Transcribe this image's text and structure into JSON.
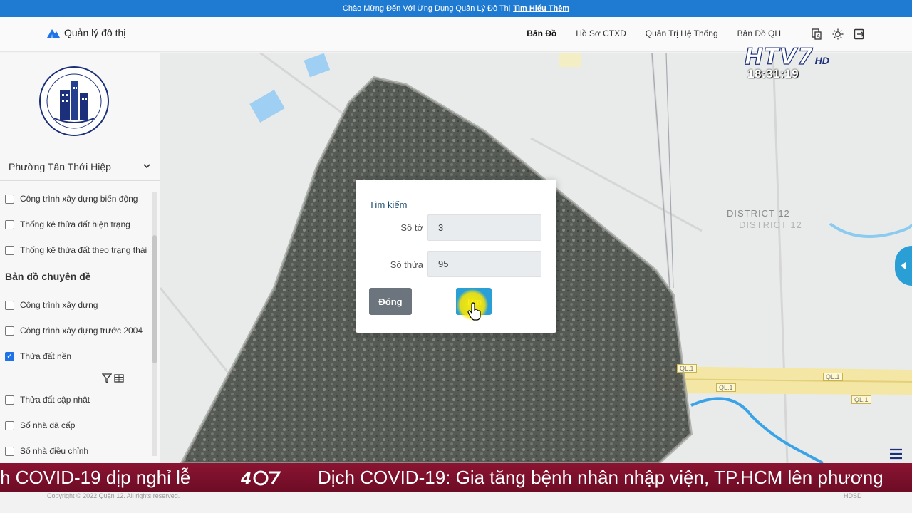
{
  "banner": {
    "text": "Chào Mừng Đến Với Ứng Dụng Quản Lý Đô Thị",
    "link": "Tìm Hiểu Thêm"
  },
  "navbar": {
    "brand": "Quản lý đô thị",
    "links": [
      "Bản Đồ",
      "Hồ Sơ CTXD",
      "Quản Trị Hệ Thống",
      "Bản Đồ QH"
    ],
    "icons": [
      "translate-icon",
      "sun-icon",
      "logout-icon"
    ]
  },
  "sidebar": {
    "ward": "Phường Tân Thới Hiệp",
    "layers_top": [
      {
        "label": "Công trình xây dựng biến động",
        "checked": false
      },
      {
        "label": "Thống kê thửa đất hiện trạng",
        "checked": false
      },
      {
        "label": "Thống kê thửa đất theo trạng thái",
        "checked": false
      }
    ],
    "section_title": "Bản đồ chuyên đề",
    "layers_theme": [
      {
        "label": "Công trình xây dựng",
        "checked": false
      },
      {
        "label": "Công trình xây dựng trước 2004",
        "checked": false
      },
      {
        "label": "Thửa đất nền",
        "checked": true
      },
      {
        "label": "Thửa đất cập nhật",
        "checked": false
      },
      {
        "label": "Số nhà đã cấp",
        "checked": false
      },
      {
        "label": "Số nhà điều chỉnh",
        "checked": false
      }
    ],
    "check_mark": "✓"
  },
  "map": {
    "district_labels": [
      "DISTRICT 12",
      "DISTRICT 12"
    ],
    "road_badges": [
      "QL.1",
      "QL.1",
      "QL.1",
      "QL.1"
    ]
  },
  "channel": {
    "name": "HTV7",
    "hd": "HD",
    "time": "18:31:19"
  },
  "search_dialog": {
    "title": "Tìm kiếm",
    "sheet_label": "Số tờ",
    "sheet_value": "3",
    "parcel_label": "Số thửa",
    "parcel_value": "95",
    "close_label": "Đóng",
    "search_label": "Tìm"
  },
  "ticker": {
    "left_text": "h COVID-19 dịp nghỉ lễ",
    "right_text": "Dịch COVID-19: Gia tăng bệnh nhân nhập viện, TP.HCM lên phương"
  },
  "footer": {
    "copyright": "Copyright © 2022 Quận 12. All rights reserved.",
    "help": "HDSD"
  },
  "colors": {
    "accent": "#2a9fd6",
    "banner": "#1f7ad1",
    "ticker": "#7a1030"
  }
}
